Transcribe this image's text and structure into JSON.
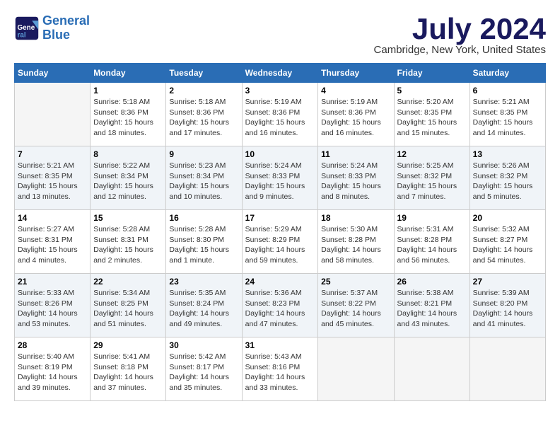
{
  "logo": {
    "line1": "General",
    "line2": "Blue"
  },
  "title": "July 2024",
  "location": "Cambridge, New York, United States",
  "days_header": [
    "Sunday",
    "Monday",
    "Tuesday",
    "Wednesday",
    "Thursday",
    "Friday",
    "Saturday"
  ],
  "weeks": [
    [
      {
        "num": "",
        "info": ""
      },
      {
        "num": "1",
        "info": "Sunrise: 5:18 AM\nSunset: 8:36 PM\nDaylight: 15 hours\nand 18 minutes."
      },
      {
        "num": "2",
        "info": "Sunrise: 5:18 AM\nSunset: 8:36 PM\nDaylight: 15 hours\nand 17 minutes."
      },
      {
        "num": "3",
        "info": "Sunrise: 5:19 AM\nSunset: 8:36 PM\nDaylight: 15 hours\nand 16 minutes."
      },
      {
        "num": "4",
        "info": "Sunrise: 5:19 AM\nSunset: 8:36 PM\nDaylight: 15 hours\nand 16 minutes."
      },
      {
        "num": "5",
        "info": "Sunrise: 5:20 AM\nSunset: 8:35 PM\nDaylight: 15 hours\nand 15 minutes."
      },
      {
        "num": "6",
        "info": "Sunrise: 5:21 AM\nSunset: 8:35 PM\nDaylight: 15 hours\nand 14 minutes."
      }
    ],
    [
      {
        "num": "7",
        "info": "Sunrise: 5:21 AM\nSunset: 8:35 PM\nDaylight: 15 hours\nand 13 minutes."
      },
      {
        "num": "8",
        "info": "Sunrise: 5:22 AM\nSunset: 8:34 PM\nDaylight: 15 hours\nand 12 minutes."
      },
      {
        "num": "9",
        "info": "Sunrise: 5:23 AM\nSunset: 8:34 PM\nDaylight: 15 hours\nand 10 minutes."
      },
      {
        "num": "10",
        "info": "Sunrise: 5:24 AM\nSunset: 8:33 PM\nDaylight: 15 hours\nand 9 minutes."
      },
      {
        "num": "11",
        "info": "Sunrise: 5:24 AM\nSunset: 8:33 PM\nDaylight: 15 hours\nand 8 minutes."
      },
      {
        "num": "12",
        "info": "Sunrise: 5:25 AM\nSunset: 8:32 PM\nDaylight: 15 hours\nand 7 minutes."
      },
      {
        "num": "13",
        "info": "Sunrise: 5:26 AM\nSunset: 8:32 PM\nDaylight: 15 hours\nand 5 minutes."
      }
    ],
    [
      {
        "num": "14",
        "info": "Sunrise: 5:27 AM\nSunset: 8:31 PM\nDaylight: 15 hours\nand 4 minutes."
      },
      {
        "num": "15",
        "info": "Sunrise: 5:28 AM\nSunset: 8:31 PM\nDaylight: 15 hours\nand 2 minutes."
      },
      {
        "num": "16",
        "info": "Sunrise: 5:28 AM\nSunset: 8:30 PM\nDaylight: 15 hours\nand 1 minute."
      },
      {
        "num": "17",
        "info": "Sunrise: 5:29 AM\nSunset: 8:29 PM\nDaylight: 14 hours\nand 59 minutes."
      },
      {
        "num": "18",
        "info": "Sunrise: 5:30 AM\nSunset: 8:28 PM\nDaylight: 14 hours\nand 58 minutes."
      },
      {
        "num": "19",
        "info": "Sunrise: 5:31 AM\nSunset: 8:28 PM\nDaylight: 14 hours\nand 56 minutes."
      },
      {
        "num": "20",
        "info": "Sunrise: 5:32 AM\nSunset: 8:27 PM\nDaylight: 14 hours\nand 54 minutes."
      }
    ],
    [
      {
        "num": "21",
        "info": "Sunrise: 5:33 AM\nSunset: 8:26 PM\nDaylight: 14 hours\nand 53 minutes."
      },
      {
        "num": "22",
        "info": "Sunrise: 5:34 AM\nSunset: 8:25 PM\nDaylight: 14 hours\nand 51 minutes."
      },
      {
        "num": "23",
        "info": "Sunrise: 5:35 AM\nSunset: 8:24 PM\nDaylight: 14 hours\nand 49 minutes."
      },
      {
        "num": "24",
        "info": "Sunrise: 5:36 AM\nSunset: 8:23 PM\nDaylight: 14 hours\nand 47 minutes."
      },
      {
        "num": "25",
        "info": "Sunrise: 5:37 AM\nSunset: 8:22 PM\nDaylight: 14 hours\nand 45 minutes."
      },
      {
        "num": "26",
        "info": "Sunrise: 5:38 AM\nSunset: 8:21 PM\nDaylight: 14 hours\nand 43 minutes."
      },
      {
        "num": "27",
        "info": "Sunrise: 5:39 AM\nSunset: 8:20 PM\nDaylight: 14 hours\nand 41 minutes."
      }
    ],
    [
      {
        "num": "28",
        "info": "Sunrise: 5:40 AM\nSunset: 8:19 PM\nDaylight: 14 hours\nand 39 minutes."
      },
      {
        "num": "29",
        "info": "Sunrise: 5:41 AM\nSunset: 8:18 PM\nDaylight: 14 hours\nand 37 minutes."
      },
      {
        "num": "30",
        "info": "Sunrise: 5:42 AM\nSunset: 8:17 PM\nDaylight: 14 hours\nand 35 minutes."
      },
      {
        "num": "31",
        "info": "Sunrise: 5:43 AM\nSunset: 8:16 PM\nDaylight: 14 hours\nand 33 minutes."
      },
      {
        "num": "",
        "info": ""
      },
      {
        "num": "",
        "info": ""
      },
      {
        "num": "",
        "info": ""
      }
    ]
  ]
}
